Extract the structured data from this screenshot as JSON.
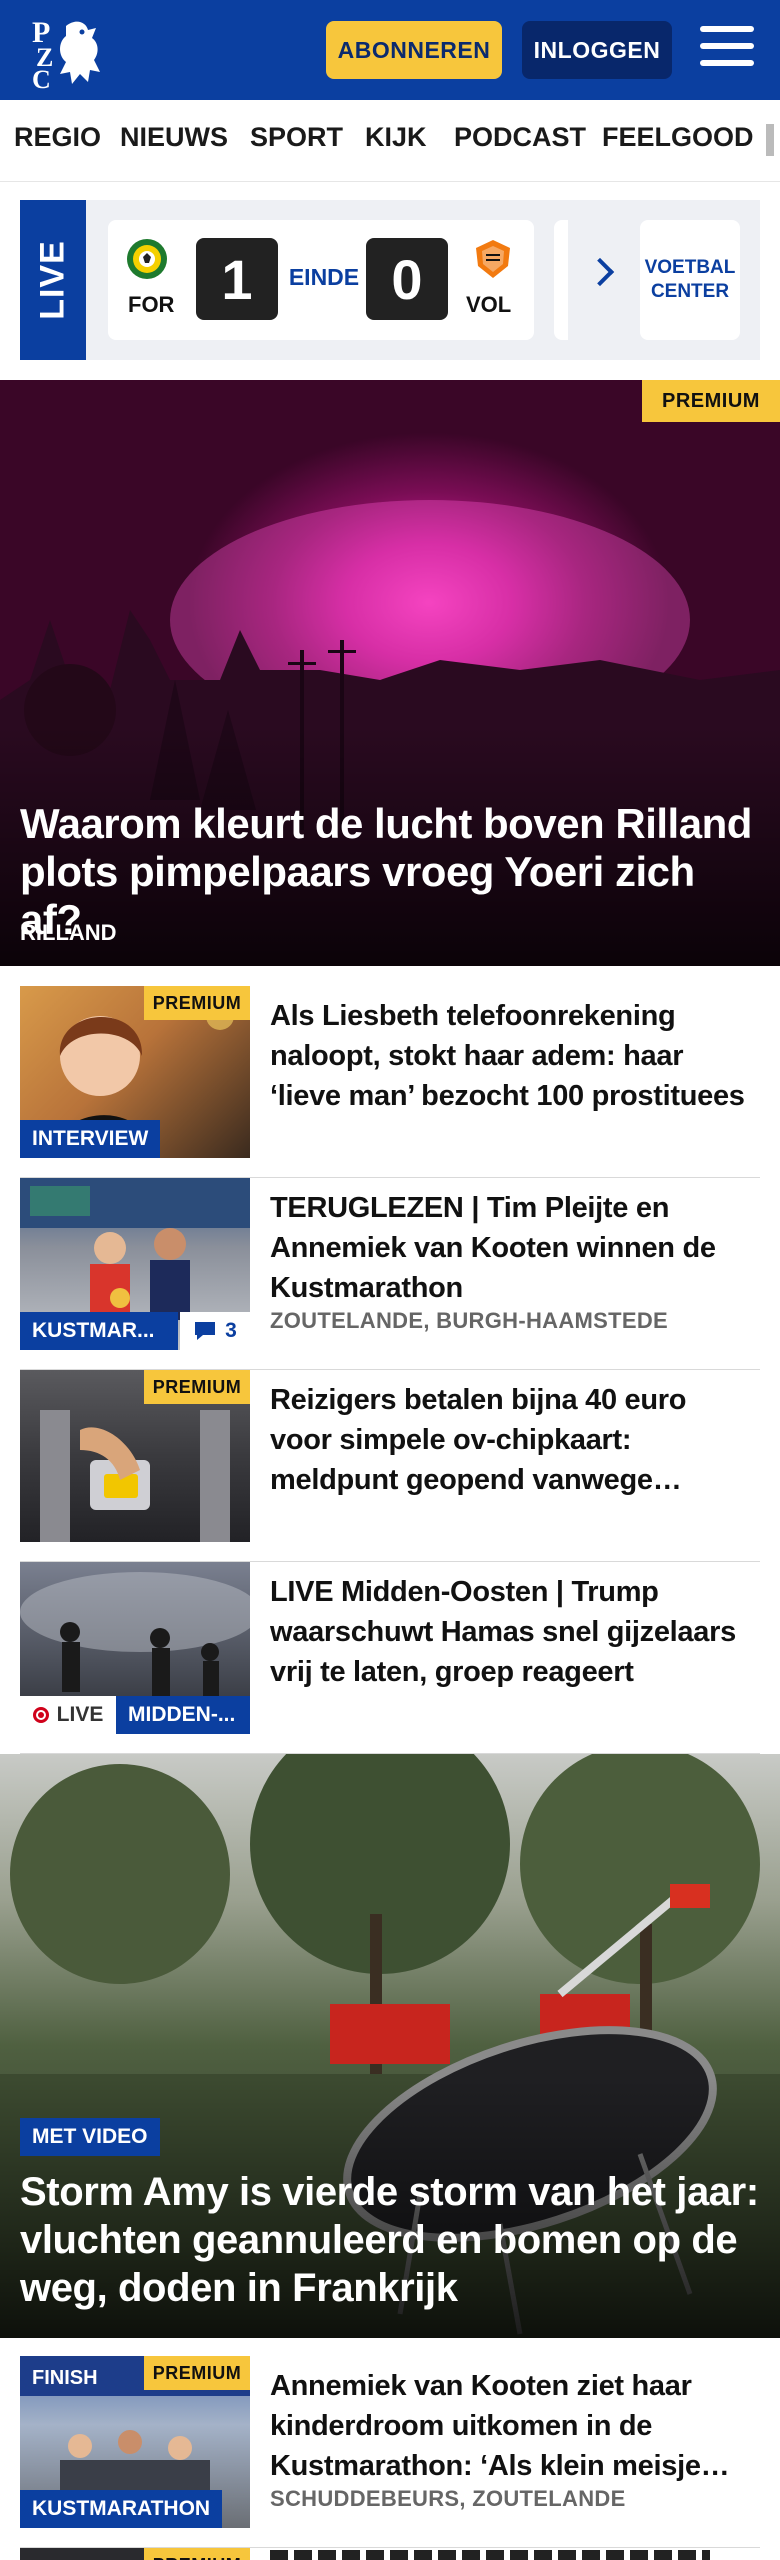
{
  "header": {
    "logo_letters": "PZC",
    "subscribe_label": "ABONNEREN",
    "login_label": "INLOGGEN",
    "brand_color": "#0b3fa0",
    "accent_color": "#f7c63c"
  },
  "nav": {
    "items": [
      {
        "label": "REGIO"
      },
      {
        "label": "NIEUWS"
      },
      {
        "label": "SPORT"
      },
      {
        "label": "KIJK"
      },
      {
        "label": "PODCAST"
      },
      {
        "label": "FEELGOOD"
      }
    ]
  },
  "live": {
    "tab_label": "LIVE",
    "match": {
      "home": "FOR",
      "away": "VOL",
      "home_score": "1",
      "away_score": "0",
      "status": "EINDE"
    },
    "voetbal_center_label": "VOETBAL CENTER"
  },
  "hero": {
    "badge": "PREMIUM",
    "title": "Waarom kleurt de lucht boven Rilland plots pimpelpaars vroeg Yoeri zich af?",
    "location": "RILLAND"
  },
  "articles": [
    {
      "badge": "PREMIUM",
      "label": "INTERVIEW",
      "title": "Als Liesbeth telefoonrekening naloopt, stokt haar adem: haar ‘lieve man’ bezocht 100 prostituees",
      "location": ""
    },
    {
      "label": "KUSTMARATHON",
      "label_short": "KUSTMAR...",
      "comments": "3",
      "title": "TERUGLEZEN | Tim Pleijte en Annemiek van Kooten winnen de Kustmarathon",
      "location": "ZOUTELANDE, BURGH-HAAMSTEDE"
    },
    {
      "badge": "PREMIUM",
      "title": "Reizigers betalen bijna 40 euro voor simpele ov-chipkaart: meldpunt geopend vanwege klachten",
      "location": ""
    },
    {
      "live_label": "LIVE",
      "label_short": "MIDDEN-...",
      "title": "LIVE Midden-Oosten | Trump waarschuwt Hamas snel gijzelaars vrij te laten, groep reageert",
      "location": ""
    }
  ],
  "storm": {
    "tag": "MET VIDEO",
    "title": "Storm Amy is vierde storm van het jaar: vluchten geannuleerd en bomen op de weg, doden in Frankrijk"
  },
  "article_last": {
    "badge": "PREMIUM",
    "label": "KUSTMARATHON",
    "title": "Annemiek van Kooten ziet haar kinderdroom uitkomen in de Kustmarathon: ‘Als klein meisje…",
    "location": "SCHUDDEBEURS, ZOUTELANDE"
  },
  "article_peek": {
    "badge": "PREMIUM"
  }
}
